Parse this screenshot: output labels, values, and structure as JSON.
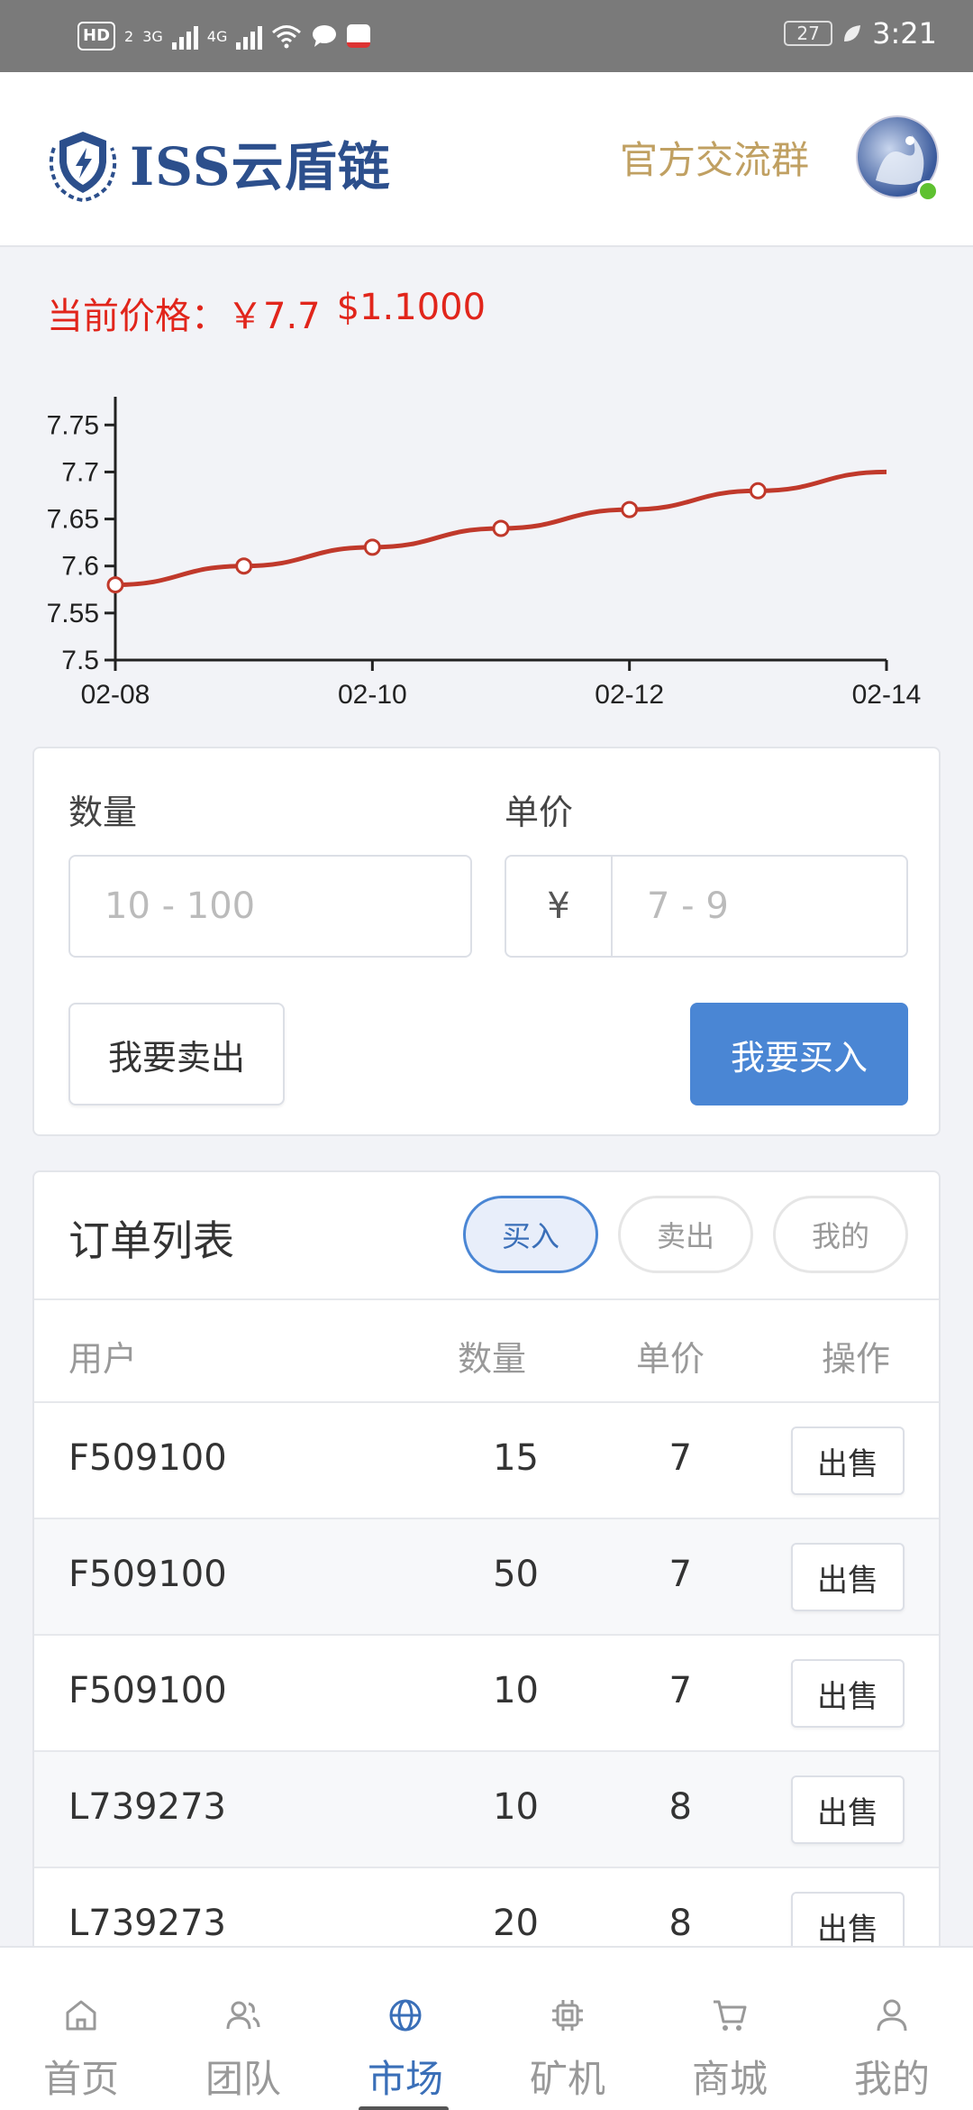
{
  "status_bar": {
    "hd_label": "HD",
    "hd_sub": "2",
    "net1": "3G",
    "net2": "4G",
    "battery": "27",
    "time": "3:21"
  },
  "header": {
    "logo_text": "ISS云盾链",
    "group_link": "官方交流群"
  },
  "price": {
    "label": "当前价格：",
    "cny": "￥7.7",
    "usd": "$1.1000"
  },
  "chart_data": {
    "type": "line",
    "x": [
      "02-08",
      "02-09",
      "02-10",
      "02-11",
      "02-12",
      "02-13",
      "02-14"
    ],
    "values": [
      7.58,
      7.6,
      7.62,
      7.64,
      7.66,
      7.68,
      7.7
    ],
    "x_ticks": [
      "02-08",
      "02-10",
      "02-12",
      "02-14"
    ],
    "y_ticks": [
      "7.5",
      "7.55",
      "7.6",
      "7.65",
      "7.7",
      "7.75"
    ],
    "ylim": [
      7.5,
      7.78
    ],
    "grid": false,
    "color": "#c0392b"
  },
  "trade": {
    "qty_label": "数量",
    "qty_placeholder": "10 - 100",
    "price_label": "单价",
    "currency": "¥",
    "price_placeholder": "7 - 9",
    "sell_btn": "我要卖出",
    "buy_btn": "我要买入"
  },
  "orders": {
    "title": "订单列表",
    "tabs": [
      {
        "label": "买入",
        "active": true
      },
      {
        "label": "卖出",
        "active": false
      },
      {
        "label": "我的",
        "active": false
      }
    ],
    "columns": [
      "用户",
      "数量",
      "单价",
      "操作"
    ],
    "rows": [
      {
        "user": "F509100",
        "qty": "15",
        "price": "7",
        "action": "出售"
      },
      {
        "user": "F509100",
        "qty": "50",
        "price": "7",
        "action": "出售"
      },
      {
        "user": "F509100",
        "qty": "10",
        "price": "7",
        "action": "出售"
      },
      {
        "user": "L739273",
        "qty": "10",
        "price": "8",
        "action": "出售"
      },
      {
        "user": "L739273",
        "qty": "20",
        "price": "8",
        "action": "出售"
      }
    ]
  },
  "tabbar": {
    "items": [
      {
        "label": "首页",
        "icon": "home-icon"
      },
      {
        "label": "团队",
        "icon": "team-icon"
      },
      {
        "label": "市场",
        "icon": "globe-icon",
        "active": true
      },
      {
        "label": "矿机",
        "icon": "chip-icon"
      },
      {
        "label": "商城",
        "icon": "cart-icon"
      },
      {
        "label": "我的",
        "icon": "user-icon"
      }
    ]
  },
  "colors": {
    "accent": "#4a86d4",
    "price_red": "#e1251b",
    "gold": "#c0a062",
    "brand_blue": "#2c4f8c"
  }
}
